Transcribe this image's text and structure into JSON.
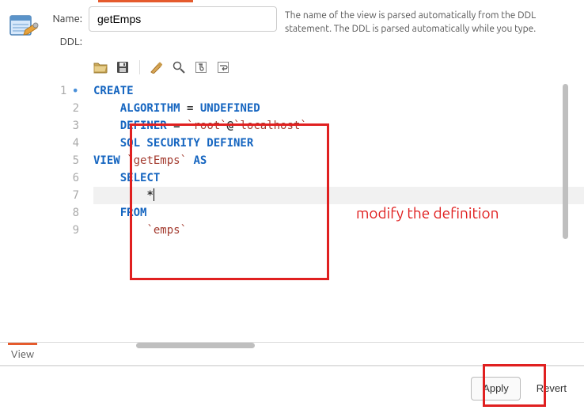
{
  "form": {
    "name_label": "Name:",
    "name_value": "getEmps",
    "ddl_label": "DDL:"
  },
  "description": "The name of the view is parsed automatically from the DDL statement. The DDL is parsed automatically while you type.",
  "toolbar": {
    "open": "open-file-icon",
    "save": "save-icon",
    "brush": "beautify-icon",
    "search": "search-icon",
    "special1": "invisible-chars-icon",
    "wrap": "word-wrap-icon"
  },
  "code_lines": [
    {
      "n": 1,
      "dot": true,
      "tokens": [
        [
          "kw",
          "CREATE "
        ]
      ]
    },
    {
      "n": 2,
      "tokens": [
        [
          "sp",
          "    "
        ],
        [
          "kw",
          "ALGORITHM"
        ],
        [
          "tk",
          " = "
        ],
        [
          "kw",
          "UNDEFINED"
        ]
      ]
    },
    {
      "n": 3,
      "tokens": [
        [
          "sp",
          "    "
        ],
        [
          "kw",
          "DEFINER"
        ],
        [
          "tk",
          " = "
        ],
        [
          "str",
          "`root`"
        ],
        [
          "tk",
          "@"
        ],
        [
          "str",
          "`localhost`"
        ]
      ]
    },
    {
      "n": 4,
      "tokens": [
        [
          "sp",
          "    "
        ],
        [
          "kw",
          "SQL SECURITY DEFINER"
        ]
      ]
    },
    {
      "n": 5,
      "tokens": [
        [
          "kw",
          "VIEW"
        ],
        [
          "tk",
          " "
        ],
        [
          "str",
          "`getEmps`"
        ],
        [
          "tk",
          " "
        ],
        [
          "kw",
          "AS"
        ]
      ]
    },
    {
      "n": 6,
      "tokens": [
        [
          "sp",
          "    "
        ],
        [
          "kw",
          "SELECT "
        ]
      ]
    },
    {
      "n": 7,
      "cursor": true,
      "hl": true,
      "tokens": [
        [
          "sp",
          "        "
        ],
        [
          "tk",
          "*"
        ]
      ]
    },
    {
      "n": 8,
      "tokens": [
        [
          "sp",
          "    "
        ],
        [
          "kw",
          "FROM"
        ]
      ]
    },
    {
      "n": 9,
      "tokens": [
        [
          "sp",
          "        "
        ],
        [
          "str",
          "`emps`"
        ]
      ]
    }
  ],
  "annotation": "modify the definition",
  "tab": {
    "label": "View"
  },
  "buttons": {
    "apply": "Apply",
    "revert": "Revert"
  }
}
